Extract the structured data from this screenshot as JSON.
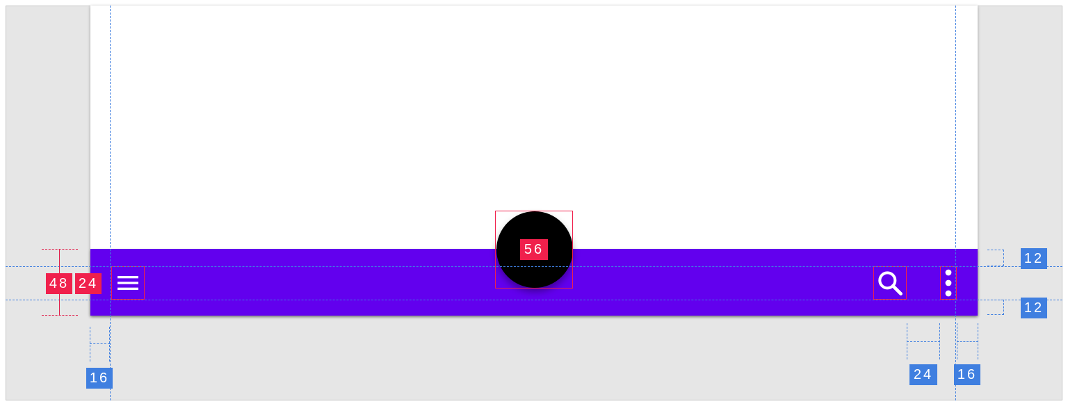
{
  "colors": {
    "app_bar": "#6200ee",
    "fab": "#000000",
    "spec_red": "#f0204c",
    "spec_blue": "#3f7fe0",
    "canvas": "#e6e6e6"
  },
  "app_bar": {
    "nav_icon": "menu-icon",
    "actions": [
      {
        "icon": "search-icon"
      },
      {
        "icon": "more-vertical-icon"
      }
    ]
  },
  "fab": {
    "icon": "none"
  },
  "spec": {
    "fab_size": "56",
    "bar_height": "48",
    "icon_size": "24",
    "top_inset": "12",
    "bottom_inset": "12",
    "left_margin": "16",
    "action_spacing": "24",
    "right_margin": "16"
  }
}
